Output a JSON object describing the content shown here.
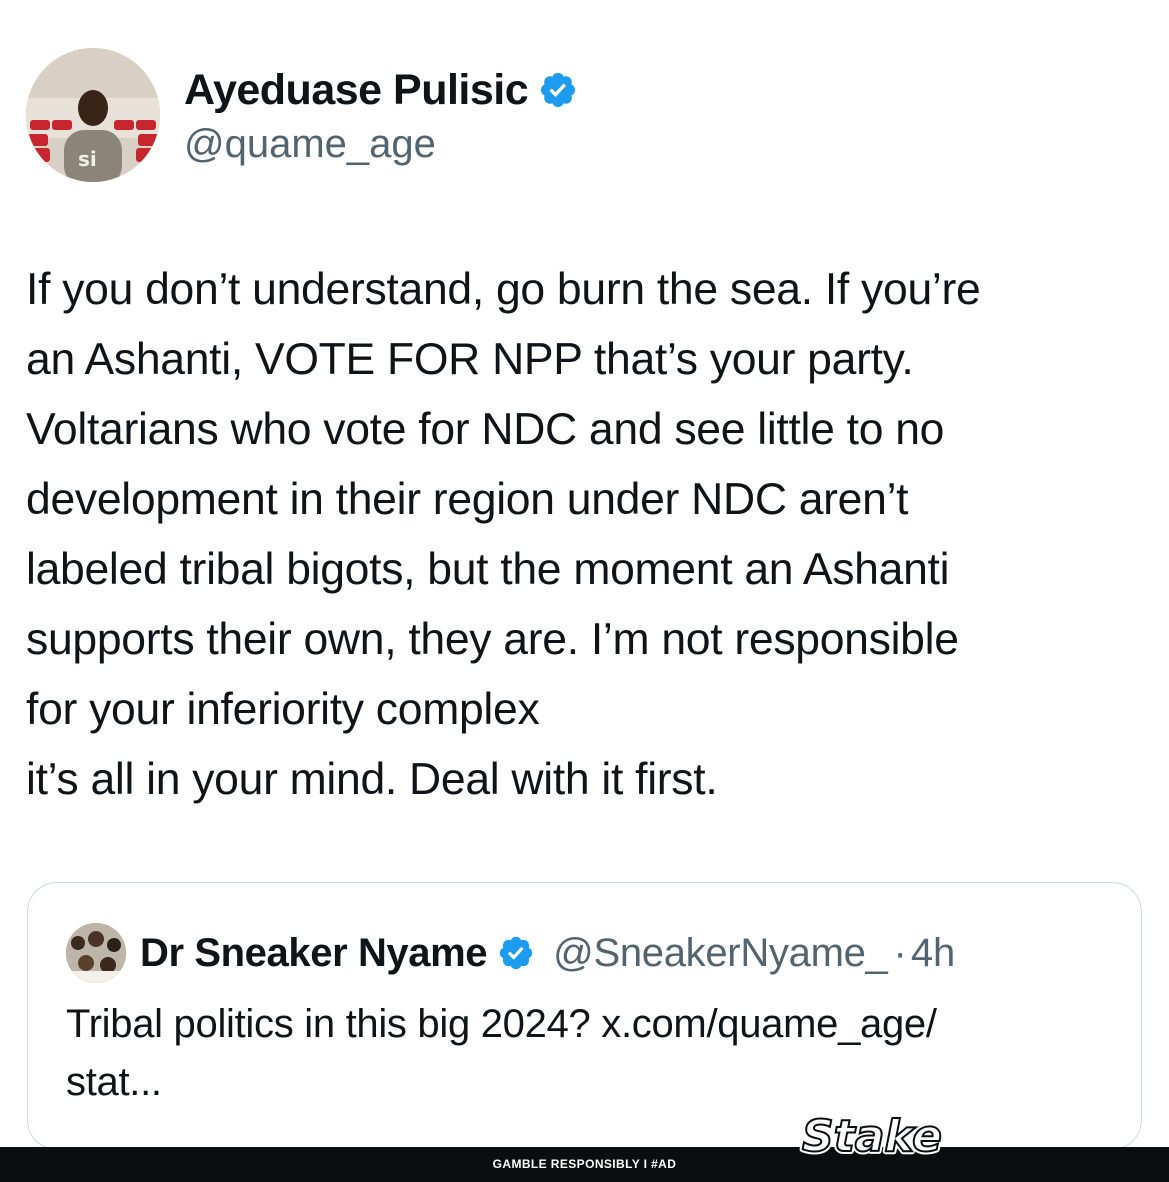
{
  "author": {
    "name": "Ayeduase Pulisic",
    "handle": "@quame_age",
    "verified": true
  },
  "tweet": {
    "lines": [
      "If you don’t understand, go burn the sea. If you’re",
      "an Ashanti, VOTE FOR NPP that’s your party.",
      "Voltarians who vote for NDC and see little to no",
      "development in their region under NDC aren’t",
      "labeled tribal bigots, but the moment an Ashanti",
      "supports their own, they are. I’m not responsible",
      "for your inferiority complex",
      "it’s all in your mind. Deal with it first."
    ]
  },
  "quote": {
    "name": "Dr Sneaker Nyame",
    "handle": "@SneakerNyame_",
    "separator": "·",
    "time": "4h",
    "verified": true,
    "lines": [
      "Tribal politics in this big 2024? x.com/quame_age/",
      "stat..."
    ]
  },
  "ad": {
    "text": "GAMBLE RESPONSIBLY  I  #AD",
    "logo_text": "Stake"
  },
  "colors": {
    "text": "#0f1419",
    "secondary": "#536471",
    "verified_blue": "#1d9bf0",
    "border": "#cfd9de",
    "ad_bar": "#0b0d10"
  },
  "icons": [
    "verified-badge-icon"
  ]
}
